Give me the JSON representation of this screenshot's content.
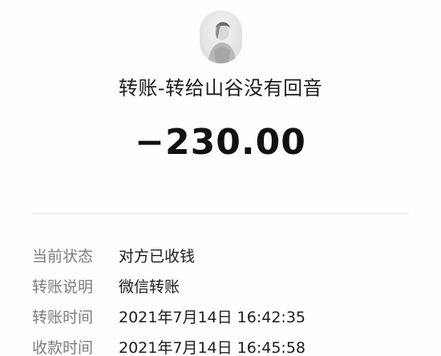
{
  "header": {
    "avatar_icon": "user-avatar",
    "title": "转账-转给山谷没有回音",
    "amount": "−230.00"
  },
  "details": [
    {
      "label": "当前状态",
      "value": "对方已收钱"
    },
    {
      "label": "转账说明",
      "value": "微信转账"
    },
    {
      "label": "转账时间",
      "value": "2021年7月14日 16:42:35"
    },
    {
      "label": "收款时间",
      "value": "2021年7月14日 16:45:58"
    }
  ]
}
